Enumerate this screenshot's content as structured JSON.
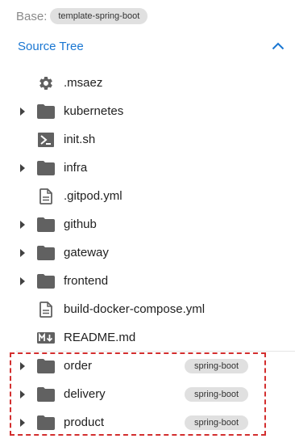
{
  "base": {
    "label": "Base:",
    "template": "template-spring-boot"
  },
  "tree": {
    "title": "Source Tree",
    "expanded": true,
    "items": [
      {
        "name": ".msaez",
        "kind": "folder-settings",
        "expandable": false
      },
      {
        "name": "kubernetes",
        "kind": "folder",
        "expandable": true
      },
      {
        "name": "init.sh",
        "kind": "shell-file",
        "expandable": false
      },
      {
        "name": "infra",
        "kind": "folder",
        "expandable": true
      },
      {
        "name": ".gitpod.yml",
        "kind": "file",
        "expandable": false
      },
      {
        "name": "github",
        "kind": "folder",
        "expandable": true
      },
      {
        "name": "gateway",
        "kind": "folder",
        "expandable": true
      },
      {
        "name": "frontend",
        "kind": "folder",
        "expandable": true
      },
      {
        "name": "build-docker-compose.yml",
        "kind": "file",
        "expandable": false
      },
      {
        "name": "README.md",
        "kind": "markdown-file",
        "expandable": false
      },
      {
        "name": "order",
        "kind": "folder",
        "expandable": true,
        "badge": "spring-boot"
      },
      {
        "name": "delivery",
        "kind": "folder",
        "expandable": true,
        "badge": "spring-boot"
      },
      {
        "name": "product",
        "kind": "folder",
        "expandable": true,
        "badge": "spring-boot"
      }
    ]
  },
  "colors": {
    "accent": "#1976d2",
    "icon": "#616161",
    "highlight": "#d32f2f",
    "chip": "#e0e0e0"
  }
}
